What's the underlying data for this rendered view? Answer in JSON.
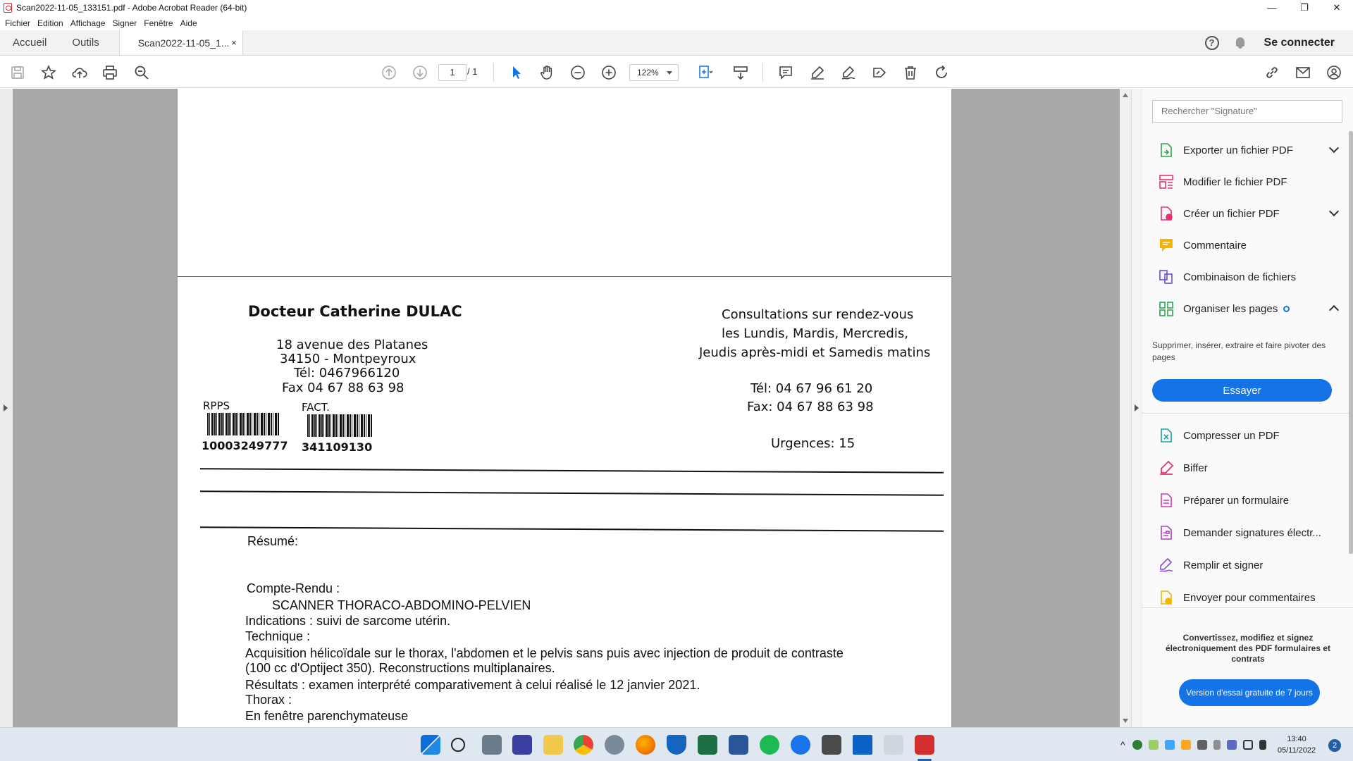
{
  "window": {
    "title": "Scan2022-11-05_133151.pdf - Adobe Acrobat Reader (64-bit)",
    "minimize": "—",
    "maximize": "❐",
    "close": "✕"
  },
  "menu": [
    "Fichier",
    "Edition",
    "Affichage",
    "Signer",
    "Fenêtre",
    "Aide"
  ],
  "tabs": {
    "home": "Accueil",
    "tools": "Outils",
    "document": "Scan2022-11-05_1...",
    "close": "×",
    "help": "?",
    "signin": "Se connecter"
  },
  "toolbar": {
    "page_current": "1",
    "page_total": "/  1",
    "zoom": "122%"
  },
  "document": {
    "doctor_name": "Docteur Catherine DULAC",
    "address_line1": "18 avenue des Platanes",
    "address_line2": "34150 - Montpeyroux",
    "phone_left": "Tél: 0467966120",
    "fax_left": "Fax  04 67 88 63 98",
    "rpps_label": "RPPS",
    "rpps_number": "10003249777",
    "fact_label": "FACT.",
    "fact_number": "341109130",
    "consult_line1": "Consultations sur rendez-vous",
    "consult_line2": "les Lundis, Mardis, Mercredis,",
    "consult_line3": "Jeudis après-midi  et Samedis matins",
    "phone_right": "Tél: 04 67 96 61 20",
    "fax_right": "Fax: 04 67 88 63 98",
    "urgences": "Urgences: 15",
    "resume": "Résumé:",
    "body_lines": [
      "Compte-Rendu :",
      "SCANNER THORACO-ABDOMINO-PELVIEN",
      "Indications : suivi de sarcome utérin.",
      "Technique :",
      "Acquisition hélicoïdale sur le thorax, l'abdomen et le pelvis sans puis avec injection de produit de contraste",
      "(100 cc d'Optiject 350). Reconstructions multiplanaires.",
      "Résultats : examen interprété comparativement à celui réalisé le 12 janvier 2021.",
      "Thorax :",
      "En fenêtre parenchymateuse"
    ]
  },
  "panel": {
    "search_placeholder": "Rechercher \"Signature\"",
    "tools": [
      {
        "label": "Exporter un fichier PDF",
        "color": "#2da44e"
      },
      {
        "label": "Modifier le fichier PDF",
        "color": "#e8336d"
      },
      {
        "label": "Créer un fichier PDF",
        "color": "#e8336d"
      },
      {
        "label": "Commentaire",
        "color": "#f5b400"
      },
      {
        "label": "Combinaison de fichiers",
        "color": "#6c4ccf"
      },
      {
        "label": "Organiser les pages",
        "color": "#2da44e"
      },
      {
        "label": "Compresser un PDF",
        "color": "#1aa3a3"
      },
      {
        "label": "Biffer",
        "color": "#e8336d"
      },
      {
        "label": "Préparer un formulaire",
        "color": "#d13bb0"
      },
      {
        "label": "Demander signatures électr...",
        "color": "#b040c8"
      },
      {
        "label": "Remplir et signer",
        "color": "#8a4dd6"
      },
      {
        "label": "Envoyer pour commentaires",
        "color": "#f5b400"
      }
    ],
    "organize_desc": "Supprimer, insérer, extraire et faire pivoter des pages",
    "try_button": "Essayer",
    "promo_text": "Convertissez, modifiez et signez électroniquement des PDF formulaires et contrats",
    "trial_button": "Version d'essai gratuite de 7 jours"
  },
  "taskbar": {
    "time": "13:40",
    "date": "05/11/2022",
    "notifications": "2",
    "chevron": "^"
  }
}
